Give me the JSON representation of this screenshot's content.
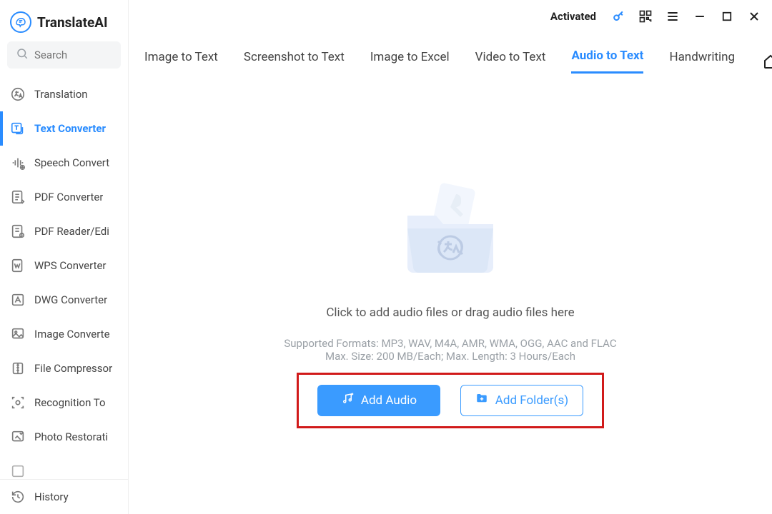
{
  "app": {
    "brand": "TranslateAI"
  },
  "search": {
    "placeholder": "Search"
  },
  "titlebar": {
    "status": "Activated"
  },
  "sidebar": {
    "items": [
      {
        "key": "translation",
        "label": "Translation",
        "icon": "translate-icon"
      },
      {
        "key": "text-converter",
        "label": "Text Converter",
        "icon": "text-convert-icon",
        "active": true
      },
      {
        "key": "speech-convert",
        "label": "Speech Convert",
        "icon": "speech-icon"
      },
      {
        "key": "pdf-converter",
        "label": "PDF Converter",
        "icon": "pdf-convert-icon"
      },
      {
        "key": "pdf-reader",
        "label": "PDF Reader/Edi",
        "icon": "pdf-reader-icon"
      },
      {
        "key": "wps-converter",
        "label": "WPS Converter",
        "icon": "wps-icon"
      },
      {
        "key": "dwg-converter",
        "label": "DWG Converter",
        "icon": "dwg-icon"
      },
      {
        "key": "image-converter",
        "label": "Image Converte",
        "icon": "image-convert-icon"
      },
      {
        "key": "file-compressor",
        "label": "File Compressor",
        "icon": "compress-icon"
      },
      {
        "key": "recognition",
        "label": "Recognition To",
        "icon": "recognition-icon"
      },
      {
        "key": "photo-restorati",
        "label": "Photo Restorati",
        "icon": "photo-restore-icon"
      }
    ],
    "footer": {
      "history": "History"
    }
  },
  "tabs": [
    {
      "key": "image-to-text",
      "label": "Image to Text"
    },
    {
      "key": "screenshot-to-text",
      "label": "Screenshot to Text"
    },
    {
      "key": "image-to-excel",
      "label": "Image to Excel"
    },
    {
      "key": "video-to-text",
      "label": "Video to Text"
    },
    {
      "key": "audio-to-text",
      "label": "Audio to Text",
      "active": true
    },
    {
      "key": "handwriting",
      "label": "Handwriting"
    }
  ],
  "content": {
    "prompt": "Click to add audio files or drag audio files here",
    "hint1": "Supported Formats: MP3, WAV, M4A, AMR, WMA, OGG, AAC and FLAC",
    "hint2": "Max. Size: 200 MB/Each; Max. Length: 3 Hours/Each",
    "add_audio": "Add Audio",
    "add_folder": "Add Folder(s)"
  },
  "colors": {
    "accent": "#2a8cff",
    "highlight_box": "#d11a1a"
  }
}
